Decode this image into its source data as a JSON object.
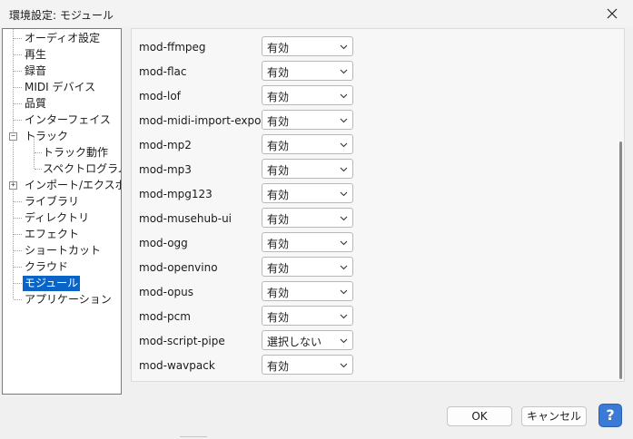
{
  "window": {
    "title": "環境設定: モジュール",
    "close_glyph": "✕"
  },
  "tree": {
    "items": [
      {
        "label": "オーディオ設定"
      },
      {
        "label": "再生"
      },
      {
        "label": "録音"
      },
      {
        "label": "MIDI デバイス"
      },
      {
        "label": "品質"
      },
      {
        "label": "インターフェイス"
      },
      {
        "label": "トラック"
      },
      {
        "label": "トラック動作"
      },
      {
        "label": "スペクトログラム"
      },
      {
        "label": "インポート/エクスポート"
      },
      {
        "label": "ライブラリ"
      },
      {
        "label": "ディレクトリ"
      },
      {
        "label": "エフェクト"
      },
      {
        "label": "ショートカット"
      },
      {
        "label": "クラウド"
      },
      {
        "label": "モジュール"
      },
      {
        "label": "アプリケーション"
      }
    ],
    "selected": "モジュール",
    "expanded_glyph": "−",
    "collapsed_glyph": "+"
  },
  "modules": [
    {
      "name": "mod-ffmpeg",
      "value": "有効"
    },
    {
      "name": "mod-flac",
      "value": "有効"
    },
    {
      "name": "mod-lof",
      "value": "有効"
    },
    {
      "name": "mod-midi-import-export",
      "value": "有効"
    },
    {
      "name": "mod-mp2",
      "value": "有効"
    },
    {
      "name": "mod-mp3",
      "value": "有効"
    },
    {
      "name": "mod-mpg123",
      "value": "有効"
    },
    {
      "name": "mod-musehub-ui",
      "value": "有効"
    },
    {
      "name": "mod-ogg",
      "value": "有効"
    },
    {
      "name": "mod-openvino",
      "value": "有効"
    },
    {
      "name": "mod-opus",
      "value": "有効"
    },
    {
      "name": "mod-pcm",
      "value": "有効"
    },
    {
      "name": "mod-script-pipe",
      "value": "選択しない"
    },
    {
      "name": "mod-wavpack",
      "value": "有効"
    }
  ],
  "buttons": {
    "ok": "OK",
    "cancel": "キャンセル",
    "help": "?"
  },
  "colors": {
    "selection": "#0a64c8",
    "help_button": "#3b7ad6"
  }
}
